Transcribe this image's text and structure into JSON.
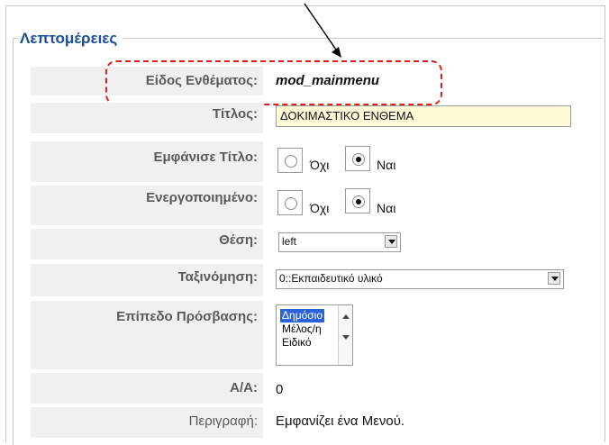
{
  "details": {
    "legend": "Λεπτομέρειες",
    "module_type_label": "Είδος Ενθέματος:",
    "module_type_value": "mod_mainmenu",
    "title_label": "Τίτλος:",
    "title_value": "ΔΟΚΙΜΑΣΤΙΚΟ  ΕΝΘΕΜΑ",
    "show_title_label": "Εμφάνισε Τίτλο:",
    "show_title_no": "Όχι",
    "show_title_yes": "Ναι",
    "show_title_selected": "yes",
    "enabled_label": "Ενεργοποιημένο:",
    "enabled_no": "Όχι",
    "enabled_yes": "Ναι",
    "enabled_selected": "yes",
    "position_label": "Θέση:",
    "position_value": "left",
    "order_label": "Ταξινόμηση:",
    "order_value": "0::Εκπαιδευτικό υλικό",
    "access_label": "Επίπεδο Πρόσβασης:",
    "access_options": [
      "Δημόσιο",
      "Μέλος/η",
      "Ειδικό"
    ],
    "access_selected": "Δημόσιο",
    "id_label": "Α/Α:",
    "id_value": "0",
    "description_label": "Περιγραφή:",
    "description_value": "Εμφανίζει ένα Μενού."
  }
}
